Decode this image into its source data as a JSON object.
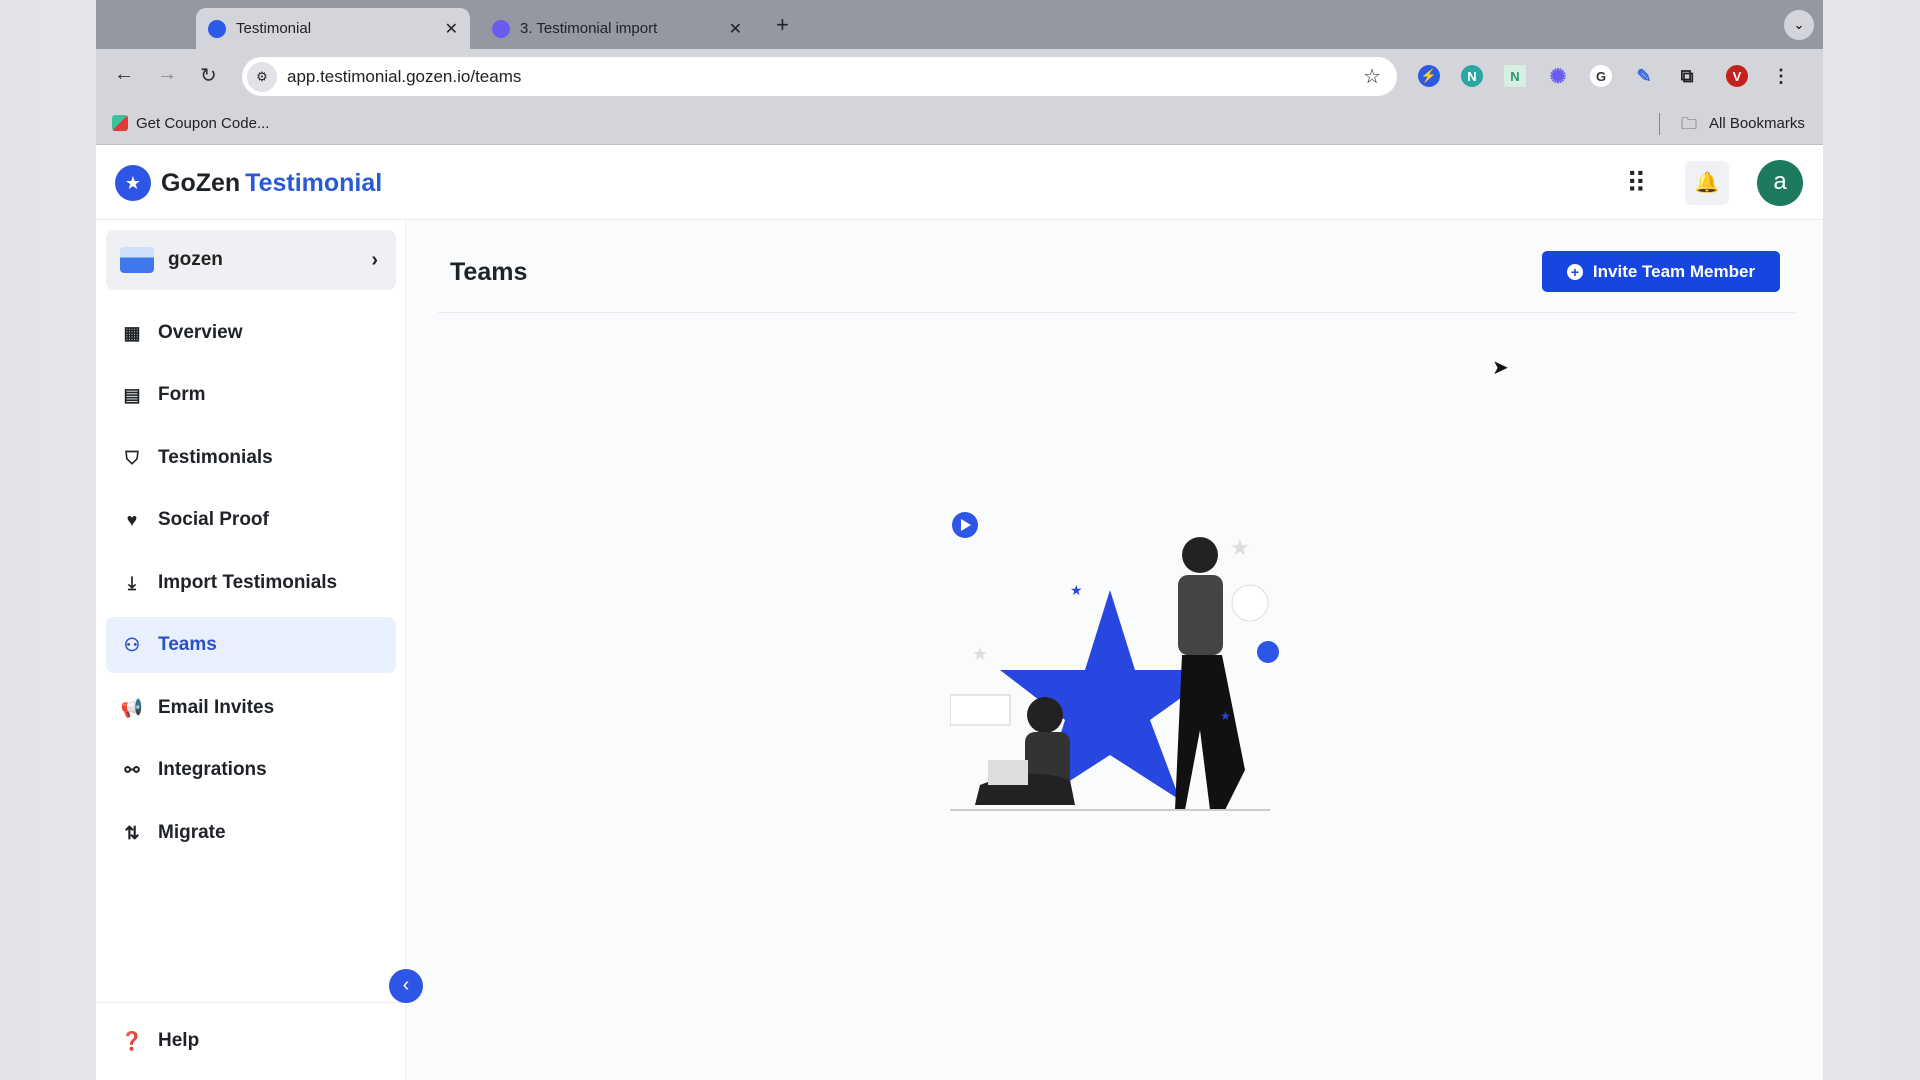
{
  "browser": {
    "tabs": [
      {
        "label": "Testimonial",
        "active": true
      },
      {
        "label": "3. Testimonial import",
        "active": false
      }
    ],
    "url": "app.testimonial.gozen.io/teams",
    "bookmark": "Get Coupon Code...",
    "all_bookmarks": "All Bookmarks",
    "profile_initial": "V",
    "ext_letters": [
      "N",
      "N"
    ]
  },
  "app": {
    "logo_word1": "GoZen",
    "logo_word2": "Testimonial",
    "avatar_initial": "a",
    "accent": "#1546e0"
  },
  "sidebar": {
    "org": "gozen",
    "items": [
      {
        "label": "Overview",
        "icon": "grid-icon"
      },
      {
        "label": "Form",
        "icon": "form-icon"
      },
      {
        "label": "Testimonials",
        "icon": "bookmark-icon"
      },
      {
        "label": "Social Proof",
        "icon": "heart-hand-icon"
      },
      {
        "label": "Import Testimonials",
        "icon": "download-icon"
      },
      {
        "label": "Teams",
        "icon": "users-icon",
        "active": true
      },
      {
        "label": "Email Invites",
        "icon": "megaphone-icon"
      },
      {
        "label": "Integrations",
        "icon": "plug-icon"
      },
      {
        "label": "Migrate",
        "icon": "arrows-icon"
      }
    ],
    "help": "Help"
  },
  "main": {
    "title": "Teams",
    "invite_button": "Invite Team Member"
  }
}
